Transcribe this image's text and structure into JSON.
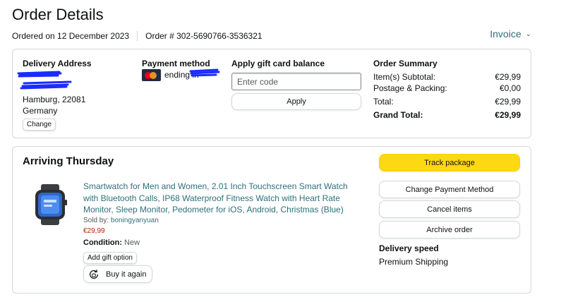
{
  "header": {
    "title": "Order Details",
    "ordered_on": "Ordered on 12 December 2023",
    "order_number": "Order # 302-5690766-3536321",
    "invoice_label": "Invoice"
  },
  "delivery": {
    "title": "Delivery Address",
    "city_line": "Hamburg, 22081",
    "country": "Germany",
    "change_label": "Change"
  },
  "payment": {
    "title": "Payment method",
    "card_text": "ending in",
    "card_icon": "mastercard-icon"
  },
  "gift_card": {
    "title": "Apply gift card balance",
    "placeholder": "Enter code",
    "apply_label": "Apply"
  },
  "summary": {
    "title": "Order Summary",
    "rows": [
      {
        "label": "Item(s) Subtotal:",
        "value": "€29,99"
      },
      {
        "label": "Postage & Packing:",
        "value": "€0,00"
      },
      {
        "label": "Total:",
        "value": "€29,99"
      },
      {
        "label": "Grand Total:",
        "value": "€29,99"
      }
    ]
  },
  "shipment": {
    "title": "Arriving Thursday",
    "product_title": "Smartwatch for Men and Women, 2.01 Inch Touchscreen Smart Watch with Bluetooth Calls, IP68 Waterproof Fitness Watch with Heart Rate Monitor, Sleep Monitor, Pedometer for iOS, Android, Christmas (Blue)",
    "sold_by_label": "Sold by:",
    "seller": "boningyanyuan",
    "price": "€29,99",
    "condition_label": "Condition:",
    "condition_value": "New",
    "gift_option_label": "Add gift option",
    "buy_again_label": "Buy it again",
    "actions": {
      "track": "Track package",
      "change_payment": "Change Payment Method",
      "cancel": "Cancel items",
      "archive": "Archive order"
    },
    "delivery_speed_title": "Delivery speed",
    "delivery_speed_value": "Premium Shipping"
  },
  "colors": {
    "link": "#2f6f7a",
    "price": "#b12704",
    "primary_button": "#ffd814",
    "redaction": "#1a2cff"
  }
}
